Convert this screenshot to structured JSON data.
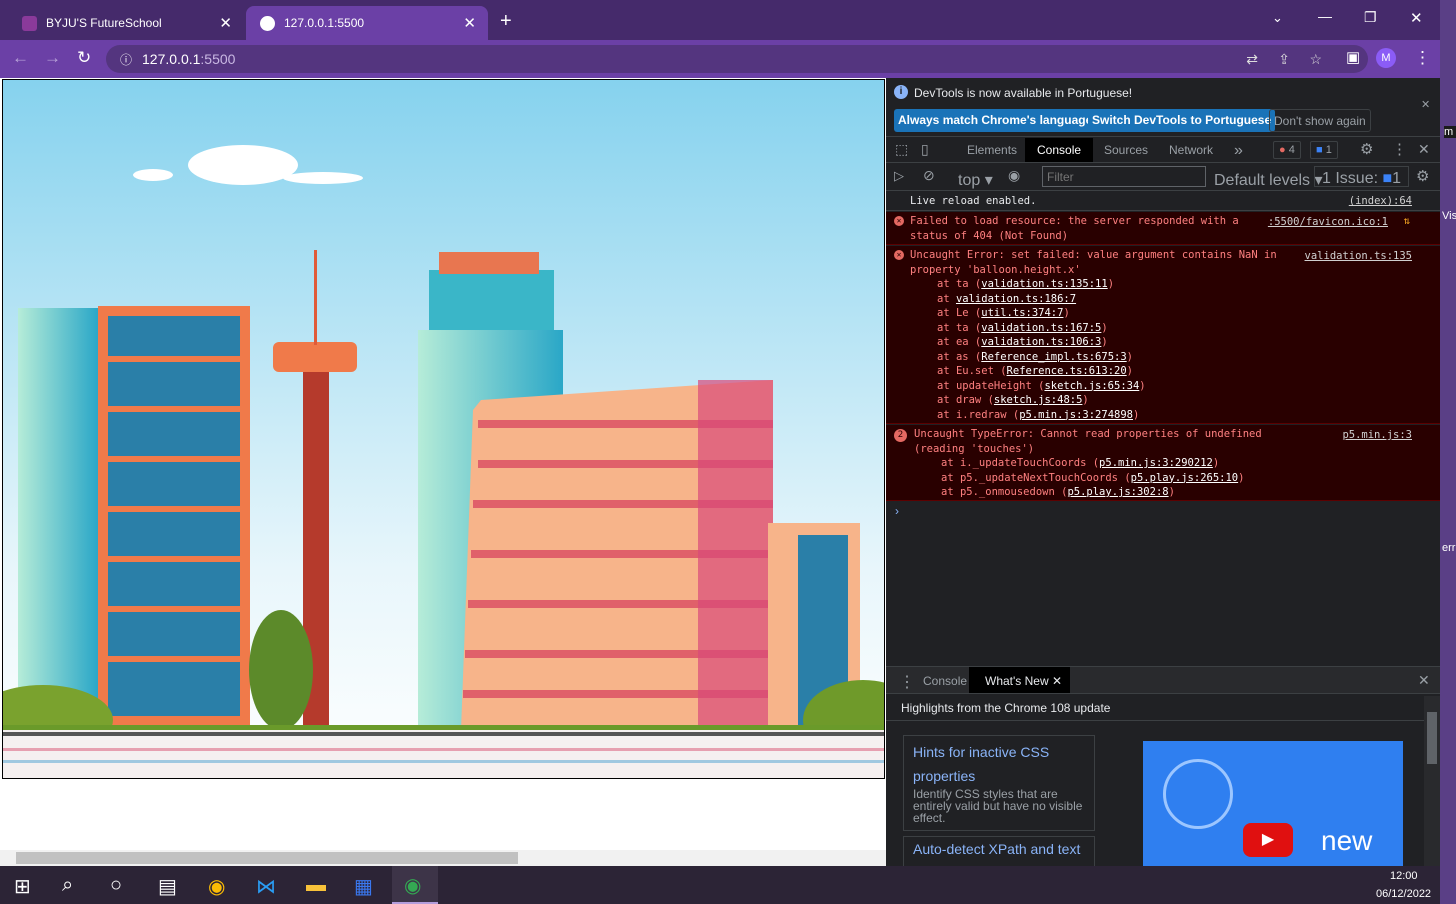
{
  "browser": {
    "tabs": [
      {
        "title": "BYJU'S FutureSchool",
        "icon": "byjus-icon"
      },
      {
        "title": "127.0.0.1:5500",
        "icon": "globe-icon"
      }
    ],
    "url_host": "127.0.0.1",
    "url_port": ":5500",
    "profile": "M"
  },
  "devtools": {
    "banner": {
      "text": "DevTools is now available in Portuguese!",
      "buttons": [
        "Always match Chrome's language",
        "Switch DevTools to Portuguese",
        "Don't show again"
      ]
    },
    "tabs": [
      "Elements",
      "Console",
      "Sources",
      "Network"
    ],
    "active_tab": "Console",
    "error_count": "4",
    "message_count": "1",
    "console_toolbar": {
      "context": "top",
      "filter_placeholder": "Filter",
      "levels": "Default levels",
      "issues_label": "1 Issue:",
      "issues_count": "1"
    },
    "messages": [
      {
        "type": "log",
        "text": "Live reload enabled.",
        "source": "(index):64"
      },
      {
        "type": "error",
        "text": "Failed to load resource: the server responded with a",
        "text2": "status of 404 (Not Found)",
        "source": ":5500/favicon.ico:1"
      },
      {
        "type": "error",
        "text": "Uncaught Error: set failed: value argument contains NaN in",
        "text2": "property 'balloon.height.x'",
        "source": "validation.ts:135",
        "stack": [
          [
            "at ta (",
            "validation.ts:135:11",
            ")"
          ],
          [
            "at ",
            "validation.ts:186:7",
            ""
          ],
          [
            "at Le (",
            "util.ts:374:7",
            ")"
          ],
          [
            "at ta (",
            "validation.ts:167:5",
            ")"
          ],
          [
            "at ea (",
            "validation.ts:106:3",
            ")"
          ],
          [
            "at as (",
            "Reference_impl.ts:675:3",
            ")"
          ],
          [
            "at Eu.set (",
            "Reference.ts:613:20",
            ")"
          ],
          [
            "at updateHeight (",
            "sketch.js:65:34",
            ")"
          ],
          [
            "at draw (",
            "sketch.js:48:5",
            ")"
          ],
          [
            "at i.redraw (",
            "p5.min.js:3:274898",
            ")"
          ]
        ]
      },
      {
        "type": "error",
        "count": "2",
        "text": "Uncaught TypeError: Cannot read properties of undefined",
        "text2": "(reading 'touches')",
        "source": "p5.min.js:3",
        "stack": [
          [
            "at i._updateTouchCoords (",
            "p5.min.js:3:290212",
            ")"
          ],
          [
            "at p5._updateNextTouchCoords (",
            "p5.play.js:265:10",
            ")"
          ],
          [
            "at p5._onmousedown (",
            "p5.play.js:302:8",
            ")"
          ]
        ]
      }
    ],
    "drawer": {
      "tabs": [
        "Console",
        "What's New"
      ],
      "heading": "Highlights from the Chrome 108 update",
      "cards": [
        {
          "title": "Hints for inactive CSS properties",
          "desc": "Identify CSS styles that are entirely valid but have no visible effect."
        },
        {
          "title": "Auto-detect XPath and text"
        }
      ],
      "video_text": "new"
    }
  },
  "right_strip": [
    "m",
    "Vis",
    "err"
  ],
  "taskbar": {
    "time": "12:00",
    "date": "06/12/2022"
  }
}
